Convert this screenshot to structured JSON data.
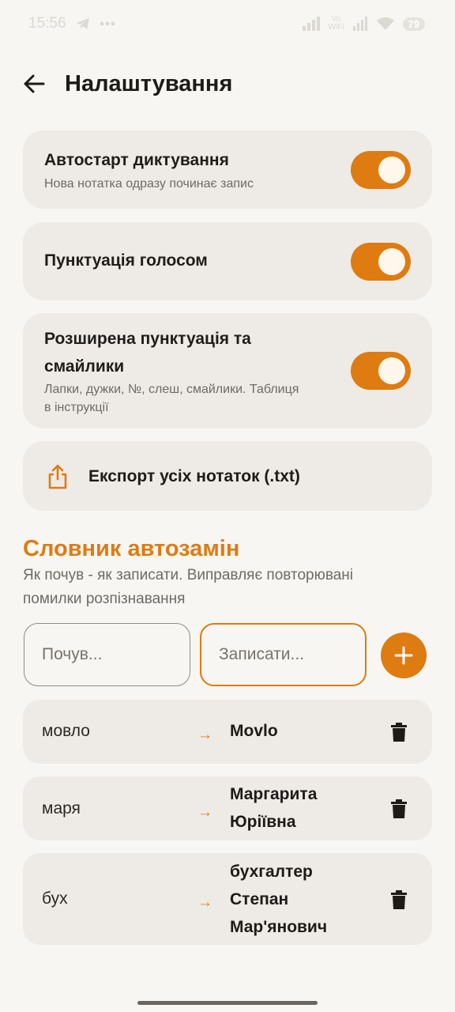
{
  "status_bar": {
    "time": "15:56",
    "vowifi_top": "Vo",
    "vowifi_bottom": "WiFi",
    "battery": "79"
  },
  "header": {
    "title": "Налаштування"
  },
  "settings": [
    {
      "title": "Автостарт диктування",
      "subtitle": "Нова нотатка одразу починає запис",
      "enabled": true
    },
    {
      "title": "Пунктуація голосом",
      "subtitle": "",
      "enabled": true
    },
    {
      "title_line1": "Розширена пунктуація та",
      "title_line2": "смайлики",
      "subtitle_line1": "Лапки, дужки, №, слеш, смайлики. Таблиця",
      "subtitle_line2": "в інструкції",
      "enabled": true
    }
  ],
  "export": {
    "label": "Експорт усіх нотаток (.txt)"
  },
  "dictionary": {
    "title": "Словник автозамін",
    "description_line1": "Як почув - як записати. Виправляє повторювані",
    "description_line2": "помилки розпізнавання",
    "heard_placeholder": "Почув...",
    "write_placeholder": "Записати...",
    "rules": [
      {
        "heard": "мовло",
        "arrow": "→",
        "write_lines": [
          "Movlo"
        ]
      },
      {
        "heard": "маря",
        "arrow": "→",
        "write_lines": [
          "Маргарита",
          "Юріївна"
        ]
      },
      {
        "heard": "бух",
        "arrow": "→",
        "write_lines": [
          "бухгалтер",
          "Степан",
          "Мар'янович"
        ]
      }
    ]
  },
  "colors": {
    "accent": "#de7b11",
    "background": "#f8f6f2",
    "card": "#eeeae5"
  }
}
